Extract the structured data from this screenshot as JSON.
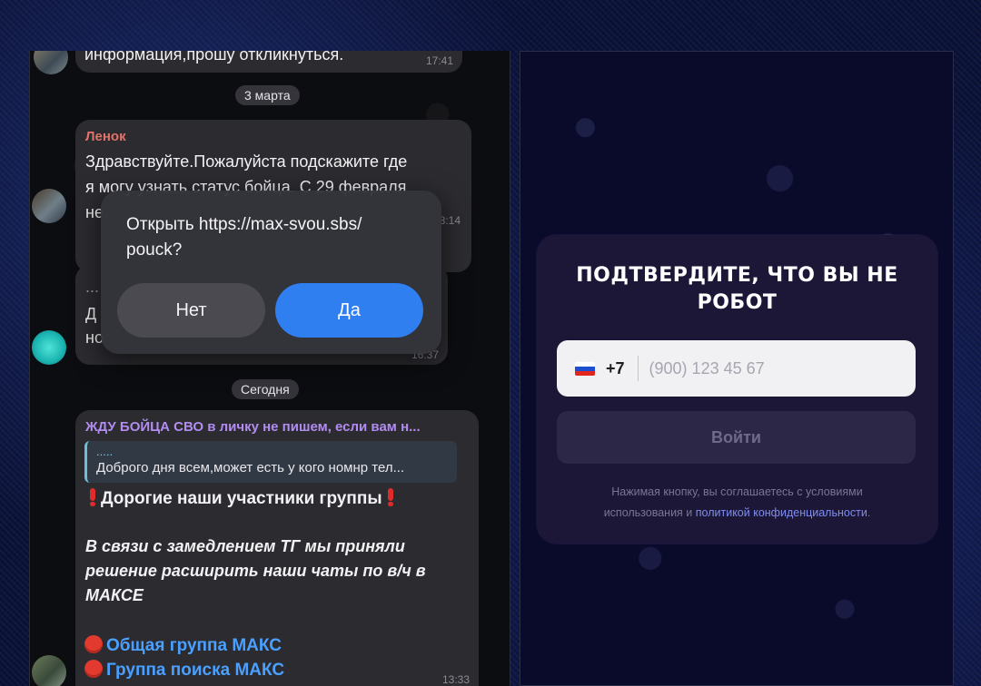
{
  "chat": {
    "top_message": {
      "text": "информация,прошу откликнуться.",
      "time": "17:41"
    },
    "date_1": "3 марта",
    "message_lenok": {
      "sender": "Ленок",
      "sender_color": "#e0736a",
      "line1": "Здравствуйте.Пожалуйста подскажите где",
      "line2": "я могу узнать статус бойца. С 29 февраля",
      "line3": "не",
      "time": "8:14"
    },
    "message_hidden": {
      "line1": "...",
      "line2": "Д",
      "line3": "но",
      "time": "16:37"
    },
    "date_2": "Сегодня",
    "message_group": {
      "sender": "ЖДУ БОЙЦА СВО в личку не пишем, если вам н...",
      "sender_color": "#b28cf0",
      "reply_dots": ".....",
      "reply_text": "Доброго дня всем,может есть у кого номнр тел...",
      "headline": "Дорогие наши участники группы",
      "italic_1": "В связи с замедлением ТГ мы приняли",
      "italic_2": "решение расширить наши чаты по в/ч в",
      "italic_3": "МАКСЕ",
      "link_1": "Общая группа МАКС",
      "link_2": "Группа поиска МАКС",
      "time": "13:33"
    }
  },
  "dialog": {
    "text_line1": "Открыть https://max-svou.sbs/",
    "text_line2": "pouck?",
    "no_label": "Нет",
    "yes_label": "Да"
  },
  "verify": {
    "title_line1": "ПОДТВЕРДИТЕ, ЧТО ВЫ НЕ",
    "title_line2": "РОБОТ",
    "country_code": "+7",
    "phone_placeholder": "(900) 123 45 67",
    "login_label": "Войти",
    "terms_part1": "Нажимая кнопку, вы соглашаетесь с условиями",
    "terms_part2": "использования и",
    "terms_link": "политикой конфиденциальности",
    "terms_end": "."
  },
  "colors": {
    "accent_blue": "#2f7ff0",
    "link_blue": "#4aa0ff",
    "card_bg": "#1c1737"
  }
}
